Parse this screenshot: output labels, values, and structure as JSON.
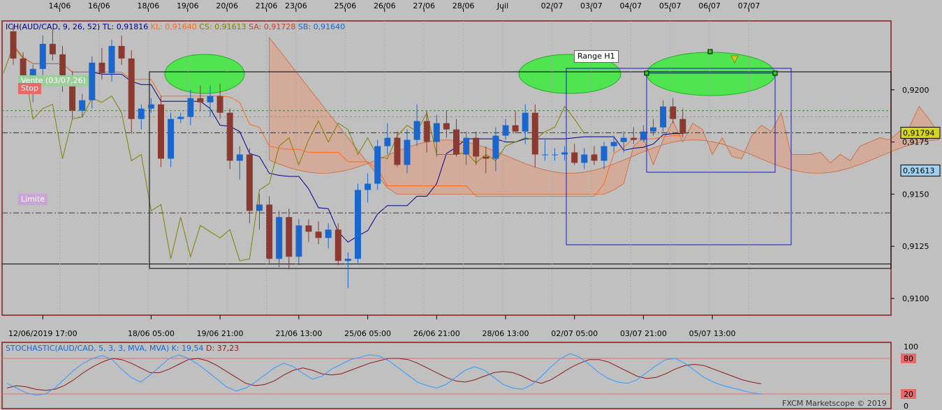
{
  "chart_data": {
    "type": "candlestick",
    "symbol": "AUD/CAD",
    "ylim": [
      0.9092,
      0.9233
    ],
    "y_ticks": [
      "0,9100",
      "0,9125",
      "0,9150",
      "0,9175",
      "0,9200"
    ],
    "price_boxes": {
      "current": "0,91794",
      "cloud": "0,91613"
    },
    "top_date_labels": [
      {
        "label": "14/06",
        "bar": 5
      },
      {
        "label": "16/06",
        "bar": 9
      },
      {
        "label": "18/06",
        "bar": 14
      },
      {
        "label": "19/06",
        "bar": 18
      },
      {
        "label": "20/06",
        "bar": 22
      },
      {
        "label": "21/06",
        "bar": 26
      },
      {
        "label": "23/06",
        "bar": 29
      },
      {
        "label": "25/06",
        "bar": 34
      },
      {
        "label": "26/06",
        "bar": 38
      },
      {
        "label": "27/06",
        "bar": 42
      },
      {
        "label": "28/06",
        "bar": 46
      },
      {
        "label": "Juil",
        "bar": 50
      },
      {
        "label": "02/07",
        "bar": 55
      },
      {
        "label": "03/07",
        "bar": 59
      },
      {
        "label": "04/07",
        "bar": 63
      },
      {
        "label": "05/07",
        "bar": 67
      },
      {
        "label": "06/07",
        "bar": 71
      },
      {
        "label": "07/07",
        "bar": 75
      }
    ],
    "bottom_time_labels": [
      {
        "label": "12/06/2019 17:00",
        "bar": 3
      },
      {
        "label": "18/06 05:00",
        "bar": 14
      },
      {
        "label": "19/06 21:00",
        "bar": 21
      },
      {
        "label": "21/06 13:00",
        "bar": 29
      },
      {
        "label": "25/06 05:00",
        "bar": 36
      },
      {
        "label": "26/06 21:00",
        "bar": 43
      },
      {
        "label": "28/06 13:00",
        "bar": 50
      },
      {
        "label": "02/07 05:00",
        "bar": 57
      },
      {
        "label": "03/07 21:00",
        "bar": 64
      },
      {
        "label": "05/07 13:00",
        "bar": 71
      }
    ],
    "candles": [
      {
        "o": 0.9228,
        "h": 0.9231,
        "l": 0.9212,
        "c": 0.9215
      },
      {
        "o": 0.9215,
        "h": 0.9218,
        "l": 0.92,
        "c": 0.9204
      },
      {
        "o": 0.9204,
        "h": 0.9212,
        "l": 0.9194,
        "c": 0.921
      },
      {
        "o": 0.921,
        "h": 0.9226,
        "l": 0.9205,
        "c": 0.9222
      },
      {
        "o": 0.9222,
        "h": 0.9229,
        "l": 0.9214,
        "c": 0.9217
      },
      {
        "o": 0.9217,
        "h": 0.9221,
        "l": 0.9199,
        "c": 0.9203
      },
      {
        "o": 0.9203,
        "h": 0.9209,
        "l": 0.9186,
        "c": 0.919
      },
      {
        "o": 0.919,
        "h": 0.9198,
        "l": 0.9187,
        "c": 0.9195
      },
      {
        "o": 0.9195,
        "h": 0.9216,
        "l": 0.9191,
        "c": 0.9213
      },
      {
        "o": 0.9213,
        "h": 0.922,
        "l": 0.9205,
        "c": 0.9208
      },
      {
        "o": 0.9208,
        "h": 0.9224,
        "l": 0.9204,
        "c": 0.9221
      },
      {
        "o": 0.9221,
        "h": 0.9226,
        "l": 0.9212,
        "c": 0.9215
      },
      {
        "o": 0.9215,
        "h": 0.9219,
        "l": 0.9179,
        "c": 0.9186
      },
      {
        "o": 0.9186,
        "h": 0.9193,
        "l": 0.9181,
        "c": 0.9191
      },
      {
        "o": 0.9191,
        "h": 0.9196,
        "l": 0.9189,
        "c": 0.9193
      },
      {
        "o": 0.9193,
        "h": 0.9197,
        "l": 0.9163,
        "c": 0.9167
      },
      {
        "o": 0.9167,
        "h": 0.9189,
        "l": 0.9163,
        "c": 0.9186
      },
      {
        "o": 0.9186,
        "h": 0.9189,
        "l": 0.9184,
        "c": 0.9187
      },
      {
        "o": 0.9187,
        "h": 0.92,
        "l": 0.9183,
        "c": 0.9196
      },
      {
        "o": 0.9196,
        "h": 0.9202,
        "l": 0.919,
        "c": 0.9194
      },
      {
        "o": 0.9194,
        "h": 0.9202,
        "l": 0.9187,
        "c": 0.9197
      },
      {
        "o": 0.9197,
        "h": 0.9203,
        "l": 0.9186,
        "c": 0.9189
      },
      {
        "o": 0.9189,
        "h": 0.9191,
        "l": 0.9162,
        "c": 0.9166
      },
      {
        "o": 0.9166,
        "h": 0.9173,
        "l": 0.9157,
        "c": 0.9169
      },
      {
        "o": 0.9169,
        "h": 0.9172,
        "l": 0.9136,
        "c": 0.9142
      },
      {
        "o": 0.9142,
        "h": 0.915,
        "l": 0.9133,
        "c": 0.9145
      },
      {
        "o": 0.9145,
        "h": 0.9149,
        "l": 0.9117,
        "c": 0.9119
      },
      {
        "o": 0.9119,
        "h": 0.9142,
        "l": 0.9115,
        "c": 0.9139
      },
      {
        "o": 0.9139,
        "h": 0.9143,
        "l": 0.9114,
        "c": 0.912
      },
      {
        "o": 0.912,
        "h": 0.9138,
        "l": 0.9116,
        "c": 0.9135
      },
      {
        "o": 0.9135,
        "h": 0.9138,
        "l": 0.9127,
        "c": 0.9132
      },
      {
        "o": 0.9132,
        "h": 0.9137,
        "l": 0.9126,
        "c": 0.9129
      },
      {
        "o": 0.9129,
        "h": 0.9136,
        "l": 0.9124,
        "c": 0.9133
      },
      {
        "o": 0.9133,
        "h": 0.9136,
        "l": 0.9116,
        "c": 0.9118
      },
      {
        "o": 0.9118,
        "h": 0.9122,
        "l": 0.9105,
        "c": 0.9119
      },
      {
        "o": 0.9119,
        "h": 0.9155,
        "l": 0.9117,
        "c": 0.9152
      },
      {
        "o": 0.9152,
        "h": 0.916,
        "l": 0.9146,
        "c": 0.9155
      },
      {
        "o": 0.9155,
        "h": 0.9176,
        "l": 0.9152,
        "c": 0.9173
      },
      {
        "o": 0.9173,
        "h": 0.9184,
        "l": 0.9169,
        "c": 0.9177
      },
      {
        "o": 0.9177,
        "h": 0.918,
        "l": 0.9163,
        "c": 0.9164
      },
      {
        "o": 0.9164,
        "h": 0.9181,
        "l": 0.916,
        "c": 0.9176
      },
      {
        "o": 0.9176,
        "h": 0.9193,
        "l": 0.9173,
        "c": 0.9185
      },
      {
        "o": 0.9185,
        "h": 0.919,
        "l": 0.917,
        "c": 0.9175
      },
      {
        "o": 0.9175,
        "h": 0.9188,
        "l": 0.9168,
        "c": 0.9184
      },
      {
        "o": 0.9184,
        "h": 0.919,
        "l": 0.9177,
        "c": 0.9181
      },
      {
        "o": 0.9181,
        "h": 0.9186,
        "l": 0.9168,
        "c": 0.9169
      },
      {
        "o": 0.9169,
        "h": 0.918,
        "l": 0.9164,
        "c": 0.9177
      },
      {
        "o": 0.9177,
        "h": 0.918,
        "l": 0.9164,
        "c": 0.9168
      },
      {
        "o": 0.9168,
        "h": 0.9173,
        "l": 0.916,
        "c": 0.9167
      },
      {
        "o": 0.9167,
        "h": 0.9182,
        "l": 0.9161,
        "c": 0.9178
      },
      {
        "o": 0.9178,
        "h": 0.9186,
        "l": 0.9176,
        "c": 0.9183
      },
      {
        "o": 0.9183,
        "h": 0.919,
        "l": 0.9179,
        "c": 0.918
      },
      {
        "o": 0.918,
        "h": 0.9193,
        "l": 0.9174,
        "c": 0.9189
      },
      {
        "o": 0.9189,
        "h": 0.9193,
        "l": 0.9163,
        "c": 0.9169
      },
      {
        "o": 0.9169,
        "h": 0.9176,
        "l": 0.9166,
        "c": 0.9169
      },
      {
        "o": 0.9169,
        "h": 0.9172,
        "l": 0.9166,
        "c": 0.9169
      },
      {
        "o": 0.9169,
        "h": 0.9173,
        "l": 0.9166,
        "c": 0.917
      },
      {
        "o": 0.917,
        "h": 0.9174,
        "l": 0.9164,
        "c": 0.9165
      },
      {
        "o": 0.9165,
        "h": 0.9172,
        "l": 0.9162,
        "c": 0.9169
      },
      {
        "o": 0.9169,
        "h": 0.9173,
        "l": 0.9164,
        "c": 0.9166
      },
      {
        "o": 0.9166,
        "h": 0.9175,
        "l": 0.9162,
        "c": 0.9173
      },
      {
        "o": 0.9173,
        "h": 0.9178,
        "l": 0.917,
        "c": 0.9175
      },
      {
        "o": 0.9175,
        "h": 0.918,
        "l": 0.917,
        "c": 0.9177
      },
      {
        "o": 0.9177,
        "h": 0.9182,
        "l": 0.9174,
        "c": 0.9176
      },
      {
        "o": 0.9176,
        "h": 0.9183,
        "l": 0.9175,
        "c": 0.918
      },
      {
        "o": 0.918,
        "h": 0.9186,
        "l": 0.9178,
        "c": 0.9182
      },
      {
        "o": 0.9182,
        "h": 0.9195,
        "l": 0.918,
        "c": 0.9192
      },
      {
        "o": 0.9192,
        "h": 0.9196,
        "l": 0.9184,
        "c": 0.9186
      },
      {
        "o": 0.9186,
        "h": 0.9191,
        "l": 0.9177,
        "c": 0.9179
      }
    ],
    "stochastic": {
      "title": "STOCHASTIC(AUD/CAD, 5, 3, 3, MVA, MVA)",
      "k_label": "K: 19,54",
      "d_label": "D: 37,23",
      "levels": [
        20,
        80
      ],
      "y_ticks": [
        "100",
        "80",
        "20",
        "0"
      ],
      "k": [
        38,
        30,
        22,
        18,
        20,
        30,
        45,
        60,
        72,
        80,
        85,
        78,
        62,
        48,
        40,
        52,
        66,
        80,
        86,
        80,
        70,
        58,
        45,
        32,
        25,
        30,
        40,
        52,
        64,
        72,
        66,
        55,
        45,
        50,
        62,
        70,
        78,
        82,
        86,
        84,
        76,
        64,
        52,
        40,
        34,
        30,
        36,
        48,
        60,
        66,
        60,
        48,
        36,
        30,
        28,
        36,
        50,
        66,
        80,
        88,
        82,
        70,
        56,
        46,
        40,
        38,
        44,
        56,
        68,
        78,
        80,
        72,
        60,
        48,
        40,
        34,
        30,
        26,
        22,
        20
      ],
      "d": [
        30,
        34,
        32,
        28,
        26,
        28,
        34,
        44,
        56,
        66,
        74,
        80,
        78,
        72,
        64,
        56,
        56,
        62,
        70,
        78,
        80,
        76,
        68,
        58,
        48,
        38,
        34,
        36,
        42,
        52,
        60,
        64,
        60,
        54,
        52,
        54,
        60,
        66,
        72,
        76,
        80,
        80,
        78,
        72,
        64,
        56,
        48,
        42,
        40,
        44,
        50,
        56,
        58,
        56,
        50,
        42,
        38,
        44,
        54,
        64,
        72,
        78,
        78,
        74,
        66,
        58,
        50,
        46,
        48,
        54,
        62,
        68,
        70,
        68,
        62,
        56,
        50,
        44,
        40,
        37
      ]
    }
  },
  "header": {
    "ich_label": "ICH(AUD/CAD, 9, 26, 52)",
    "tl_label": "TL: 0,91816",
    "kl_label": "KL: 0,91640",
    "cs_label": "CS: 0,91613",
    "sa_label": "SA: 0,91728",
    "sb_label": "SB: 0,91640"
  },
  "labels": {
    "range": "Range H1",
    "vente": "Vente (03/07,26)",
    "stop": "Stop",
    "limite": "Limite",
    "credit": "FXCM Marketscope © 2019"
  },
  "colors": {
    "background": "#c0c0c0",
    "bull": "#1a66cc",
    "bear": "#8b3a32",
    "tenkan": "#00008b",
    "kijun": "#ff6a1a",
    "chikou": "#808000",
    "cloud_bear": "#d9a48f",
    "cloud_bull": "#7fb0cc",
    "k_line": "#3399ff",
    "d_line": "#8b1a1a"
  }
}
